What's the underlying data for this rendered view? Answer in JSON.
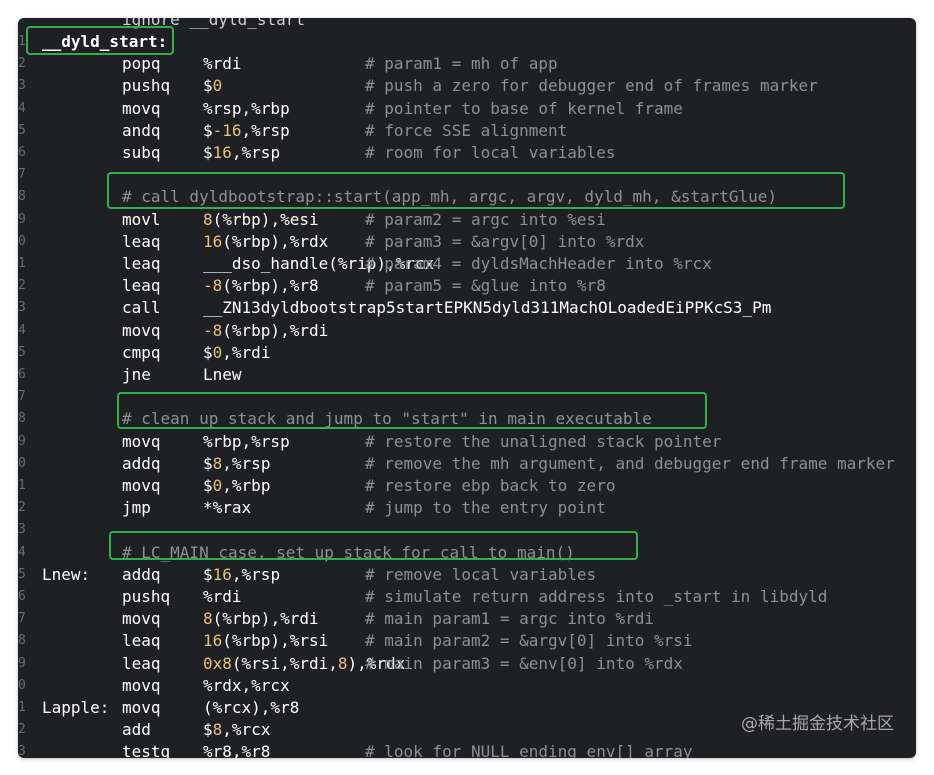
{
  "code": {
    "top_partial": "ignore __dyld_start",
    "lines": [
      {
        "gutter": "1",
        "label": "__dyld_start:",
        "mnemonic": "",
        "operands": "",
        "comment": ""
      },
      {
        "gutter": "2",
        "label": "",
        "mnemonic": "popq",
        "operands": "%rdi",
        "comment": "# param1 = mh of app"
      },
      {
        "gutter": "3",
        "label": "",
        "mnemonic": "pushq",
        "operands": "$0",
        "comment": "# push a zero for debugger end of frames marker"
      },
      {
        "gutter": "4",
        "label": "",
        "mnemonic": "movq",
        "operands": "%rsp,%rbp",
        "comment": "# pointer to base of kernel frame"
      },
      {
        "gutter": "5",
        "label": "",
        "mnemonic": "andq",
        "operands": "$-16,%rsp",
        "comment": "# force SSE alignment"
      },
      {
        "gutter": "6",
        "label": "",
        "mnemonic": "subq",
        "operands": "$16,%rsp",
        "comment": "# room for local variables"
      },
      {
        "gutter": "7",
        "label": "",
        "mnemonic": "",
        "operands": "",
        "comment": ""
      },
      {
        "gutter": "8",
        "section": "# call dyldbootstrap::start(app_mh, argc, argv, dyld_mh, &startGlue)"
      },
      {
        "gutter": "9",
        "label": "",
        "mnemonic": "movl",
        "operands": "8(%rbp),%esi",
        "comment": "# param2 = argc into %esi"
      },
      {
        "gutter": "0",
        "label": "",
        "mnemonic": "leaq",
        "operands": "16(%rbp),%rdx",
        "comment": "# param3 = &argv[0] into %rdx"
      },
      {
        "gutter": "1",
        "label": "",
        "mnemonic": "leaq",
        "operands": "___dso_handle(%rip),%rcx",
        "comment": "# param4 = dyldsMachHeader into %rcx"
      },
      {
        "gutter": "2",
        "label": "",
        "mnemonic": "leaq",
        "operands": "-8(%rbp),%r8",
        "comment": "# param5 = &glue into %r8"
      },
      {
        "gutter": "3",
        "label": "",
        "mnemonic": "call",
        "operands": "__ZN13dyldbootstrap5startEPKN5dyld311MachOLoadedEiPPKcS3_Pm",
        "comment": ""
      },
      {
        "gutter": "4",
        "label": "",
        "mnemonic": "movq",
        "operands": "-8(%rbp),%rdi",
        "comment": ""
      },
      {
        "gutter": "5",
        "label": "",
        "mnemonic": "cmpq",
        "operands": "$0,%rdi",
        "comment": ""
      },
      {
        "gutter": "6",
        "label": "",
        "mnemonic": "jne",
        "operands": "Lnew",
        "comment": ""
      },
      {
        "gutter": "7",
        "label": "",
        "mnemonic": "",
        "operands": "",
        "comment": ""
      },
      {
        "gutter": "8",
        "section": "# clean up stack and jump to \"start\" in main executable"
      },
      {
        "gutter": "9",
        "label": "",
        "mnemonic": "movq",
        "operands": "%rbp,%rsp",
        "comment": "# restore the unaligned stack pointer"
      },
      {
        "gutter": "0",
        "label": "",
        "mnemonic": "addq",
        "operands": "$8,%rsp",
        "comment": "# remove the mh argument, and debugger end frame marker"
      },
      {
        "gutter": "1",
        "label": "",
        "mnemonic": "movq",
        "operands": "$0,%rbp",
        "comment": "# restore ebp back to zero"
      },
      {
        "gutter": "2",
        "label": "",
        "mnemonic": "jmp",
        "operands": "*%rax",
        "comment": "# jump to the entry point"
      },
      {
        "gutter": "3",
        "label": "",
        "mnemonic": "",
        "operands": "",
        "comment": ""
      },
      {
        "gutter": "4",
        "section": "# LC_MAIN case, set up stack for call to main()"
      },
      {
        "gutter": "5",
        "label": "Lnew:",
        "mnemonic": "addq",
        "operands": "$16,%rsp",
        "comment": "# remove local variables"
      },
      {
        "gutter": "6",
        "label": "",
        "mnemonic": "pushq",
        "operands": "%rdi",
        "comment": "# simulate return address into _start in libdyld"
      },
      {
        "gutter": "7",
        "label": "",
        "mnemonic": "movq",
        "operands": "8(%rbp),%rdi",
        "comment": "# main param1 = argc into %rdi"
      },
      {
        "gutter": "8",
        "label": "",
        "mnemonic": "leaq",
        "operands": "16(%rbp),%rsi",
        "comment": "# main param2 = &argv[0] into %rsi"
      },
      {
        "gutter": "9",
        "label": "",
        "mnemonic": "leaq",
        "operands": "0x8(%rsi,%rdi,8),%rdx",
        "comment": "# main param3 = &env[0] into %rdx"
      },
      {
        "gutter": "0",
        "label": "",
        "mnemonic": "movq",
        "operands": "%rdx,%rcx",
        "comment": ""
      },
      {
        "gutter": "1",
        "label": "Lapple:",
        "mnemonic": "movq",
        "operands": "(%rcx),%r8",
        "comment": ""
      },
      {
        "gutter": "2",
        "label": "",
        "mnemonic": "add",
        "operands": "$8,%rcx",
        "comment": ""
      },
      {
        "gutter": "3",
        "label": "",
        "mnemonic": "testq",
        "operands": "%r8,%r8",
        "comment": "# look for NULL ending env[] array"
      }
    ]
  },
  "watermark": "@稀土掘金技术社区",
  "colors": {
    "background": "#1f2024",
    "text": "#ffffff",
    "comment": "#8e9097",
    "number": "#e5c07b",
    "highlight_box": "#2fb04a"
  }
}
